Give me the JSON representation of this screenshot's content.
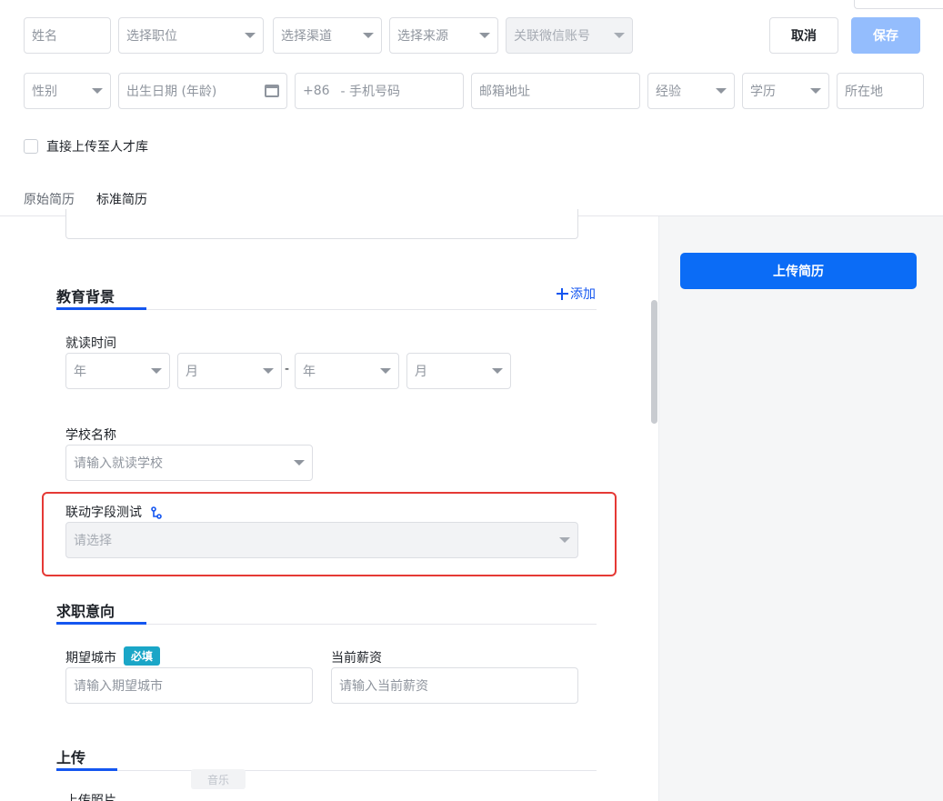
{
  "header": {
    "row1": {
      "name_placeholder": "姓名",
      "position_placeholder": "选择职位",
      "channel_placeholder": "选择渠道",
      "source_placeholder": "选择来源",
      "wechat_placeholder": "关联微信账号"
    },
    "row2": {
      "gender_placeholder": "性别",
      "birth_placeholder": "出生日期 (年龄)",
      "country_code": "+86",
      "phone_placeholder": "- 手机号码",
      "email_placeholder": "邮箱地址",
      "experience_placeholder": "经验",
      "education_placeholder": "学历",
      "location_placeholder": "所在地"
    },
    "cancel_label": "取消",
    "save_label": "保存",
    "upload_to_pool_label": "直接上传至人才库"
  },
  "tabs": [
    {
      "label": "原始简历",
      "active": false
    },
    {
      "label": "标准简历",
      "active": true
    }
  ],
  "right_panel": {
    "upload_resume_label": "上传简历"
  },
  "education": {
    "title": "教育背景",
    "add_label": "添加",
    "period_label": "就读时间",
    "start_year": "年",
    "start_month": "月",
    "separator": "-",
    "end_year": "年",
    "end_month": "月",
    "school_label": "学校名称",
    "school_placeholder": "请输入就读学校",
    "linked_field_label": "联动字段测试",
    "linked_field_placeholder": "请选择"
  },
  "job_intent": {
    "title": "求职意向",
    "city_label": "期望城市",
    "required_badge": "必填",
    "city_placeholder": "请输入期望城市",
    "salary_label": "当前薪资",
    "salary_placeholder": "请输入当前薪资"
  },
  "upload": {
    "title": "上传",
    "photo_label": "上传照片",
    "ghost_tooltip": "音乐"
  },
  "colors": {
    "primary": "#1456f0",
    "upload_button": "#0b6cf6",
    "save_disabled": "#94bdfd",
    "required_badge": "#1aa6c7",
    "highlight_border": "#e53935"
  }
}
